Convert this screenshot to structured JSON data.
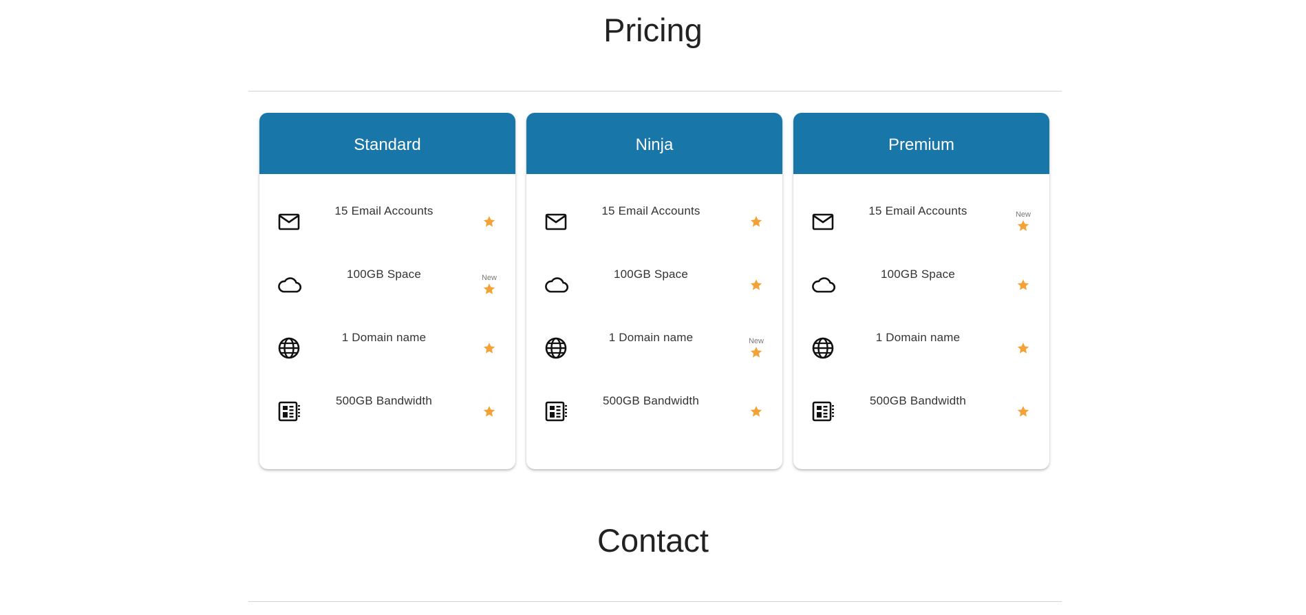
{
  "sections": {
    "pricing_title": "Pricing",
    "contact_title": "Contact"
  },
  "colors": {
    "header_bg": "#1976a9",
    "star": "#f4a236"
  },
  "plans": [
    {
      "name": "Standard",
      "features": [
        {
          "icon": "email-icon",
          "label": "15 Email Accounts",
          "new_label": ""
        },
        {
          "icon": "cloud-icon",
          "label": "100GB Space",
          "new_label": "New"
        },
        {
          "icon": "globe-icon",
          "label": "1 Domain name",
          "new_label": ""
        },
        {
          "icon": "bandwidth-icon",
          "label": "500GB Bandwidth",
          "new_label": ""
        }
      ]
    },
    {
      "name": "Ninja",
      "features": [
        {
          "icon": "email-icon",
          "label": "15 Email Accounts",
          "new_label": ""
        },
        {
          "icon": "cloud-icon",
          "label": "100GB Space",
          "new_label": ""
        },
        {
          "icon": "globe-icon",
          "label": "1 Domain name",
          "new_label": "New"
        },
        {
          "icon": "bandwidth-icon",
          "label": "500GB Bandwidth",
          "new_label": ""
        }
      ]
    },
    {
      "name": "Premium",
      "features": [
        {
          "icon": "email-icon",
          "label": "15 Email Accounts",
          "new_label": "New"
        },
        {
          "icon": "cloud-icon",
          "label": "100GB Space",
          "new_label": ""
        },
        {
          "icon": "globe-icon",
          "label": "1 Domain name",
          "new_label": ""
        },
        {
          "icon": "bandwidth-icon",
          "label": "500GB Bandwidth",
          "new_label": ""
        }
      ]
    }
  ]
}
